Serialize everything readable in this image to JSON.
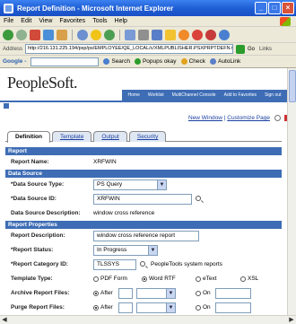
{
  "window": {
    "title": "Report Definition - Microsoft Internet Explorer"
  },
  "menu": [
    "File",
    "Edit",
    "View",
    "Favorites",
    "Tools",
    "Help"
  ],
  "address": {
    "label": "Address",
    "url": "http://216.131.225.194/psp/ps/EMPLOYEE/QE_LOCAL/c/XMLPUBLISHER.PSXPRPTDEFN.GB",
    "go": "Go",
    "links": "Links"
  },
  "googlebar": {
    "logo": "Google -",
    "search": "Search",
    "popups": "Popups okay",
    "check": "Check",
    "autolink": "AutoLink"
  },
  "peoplesoft": {
    "logo": "PeopleSoft.",
    "nav": [
      "Home",
      "Worklist",
      "MultiChannel Console",
      "Add to Favorites",
      "Sign out"
    ],
    "new_window": "New Window",
    "customize": "Customize Page"
  },
  "tabs": [
    "Definition",
    "Template",
    "Output",
    "Security"
  ],
  "sections": {
    "report": "Report",
    "data_source": "Data Source",
    "properties": "Report Properties"
  },
  "fields": {
    "report_name_label": "Report Name:",
    "report_name": "XRFWIN",
    "ds_type_label": "*Data Source Type:",
    "ds_type": "PS Query",
    "ds_id_label": "*Data Source ID:",
    "ds_id": "XRFWIN",
    "ds_desc_label": "Data Source Description:",
    "ds_desc": "window cross reference",
    "rpt_desc_label": "Report Description:",
    "rpt_desc": "window cross reference report",
    "status_label": "*Report Status:",
    "status": "In Progress",
    "category_label": "*Report Category ID:",
    "category": "TLSSYS",
    "category_desc": "PeopleTools system reports",
    "template_label": "Template Type:",
    "template_opts": [
      "PDF Form",
      "Word RTF",
      "eText",
      "XSL"
    ],
    "archive_label": "Archive Report Files:",
    "purge_label": "Purge Report Files:",
    "after": "After",
    "on": "On"
  }
}
